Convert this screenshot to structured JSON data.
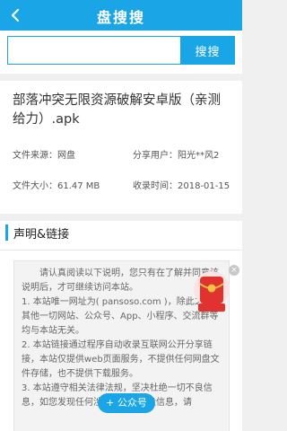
{
  "header": {
    "title": "盘搜搜",
    "back_icon": "back-arrow-icon"
  },
  "search": {
    "value": "",
    "placeholder": "",
    "button_label": "搜搜"
  },
  "file": {
    "title": "部落冲突无限资源破解安卓版（亲测给力）.apk",
    "source_label": "文件来源：",
    "source_value": "网盘",
    "sharer_label": "分享用户：",
    "sharer_value": "阳光**风2",
    "size_label": "文件大小：",
    "size_value": "61.47 MB",
    "time_label": "收录时间：",
    "time_value": "2018-01-15"
  },
  "statement": {
    "title": "声明&链接",
    "paragraphs": [
      "请认真阅读以下说明，您只有在了解并同意该说明后，才可继续访问本站。",
      "1. 本站唯一网址为( pansoso.com )，除此之外，其他一切网站、公众号、App、小程序、交流群等均与本站无关。",
      "2. 本站链接通过程序自动收录互联网公开分享链接，本站仅提供web页面服务，不提供任何网盘文件存储，也不提供下载服务。",
      "3. 本站遵守相关法律法规，坚决杜绝一切不良信息，如您发现任何涉嫌违规的网盘信息，请"
    ]
  },
  "fab": {
    "label": "+ 公众号"
  },
  "ad": {
    "close_label": "×",
    "icon": "red-envelope-icon"
  },
  "colors": {
    "accent": "#1aa6e6"
  }
}
